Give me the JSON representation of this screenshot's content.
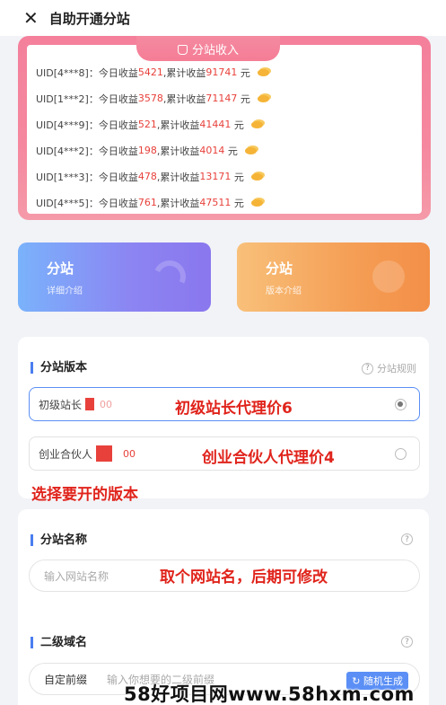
{
  "header": {
    "title": "自助开通分站"
  },
  "income": {
    "tab_label": "分站收入",
    "rows": [
      {
        "uid": "UID[4***8]：",
        "today_label": "今日收益",
        "today": "5421",
        "total_label": ",累计收益",
        "total": "91741",
        "unit": "元"
      },
      {
        "uid": "UID[1***2]：",
        "today_label": "今日收益",
        "today": "3578",
        "total_label": ",累计收益",
        "total": "71147",
        "unit": "元"
      },
      {
        "uid": "UID[4***9]：",
        "today_label": "今日收益",
        "today": "521",
        "total_label": ",累计收益",
        "total": "41441",
        "unit": "元"
      },
      {
        "uid": "UID[4***2]：",
        "today_label": "今日收益",
        "today": "198",
        "total_label": ",累计收益",
        "total": "4014",
        "unit": "元"
      },
      {
        "uid": "UID[1***3]：",
        "today_label": "今日收益",
        "today": "478",
        "total_label": ",累计收益",
        "total": "13171",
        "unit": "元"
      },
      {
        "uid": "UID[4***5]：",
        "today_label": "今日收益",
        "today": "761",
        "total_label": ",累计收益",
        "total": "47511",
        "unit": "元"
      }
    ]
  },
  "promos": {
    "left": {
      "title": "分站",
      "subtitle": "详细介绍"
    },
    "right": {
      "title": "分站",
      "subtitle": "版本介绍"
    }
  },
  "version": {
    "title": "分站版本",
    "rules_label": "分站规则",
    "options": [
      {
        "label": "初级站长",
        "price_suffix": "00",
        "selected": true
      },
      {
        "label": "创业合伙人",
        "price_suffix": "00",
        "selected": false
      }
    ]
  },
  "site_name": {
    "title": "分站名称",
    "placeholder": "输入网站名称"
  },
  "domain": {
    "title": "二级域名",
    "prefix": "自定前缀",
    "placeholder": "输入你想要的二级前缀",
    "generate_label": "随机生成"
  },
  "annotations": {
    "option1": "初级站长代理价6",
    "option2": "创业合伙人代理价4",
    "choose": "选择要开的版本",
    "name": "取个网站名，后期可修改"
  },
  "watermark": "58好项目网www.58hxm.com",
  "colors": {
    "accent": "#5b8ff5",
    "income_pink": "#f4809b",
    "red": "#e8413b"
  }
}
